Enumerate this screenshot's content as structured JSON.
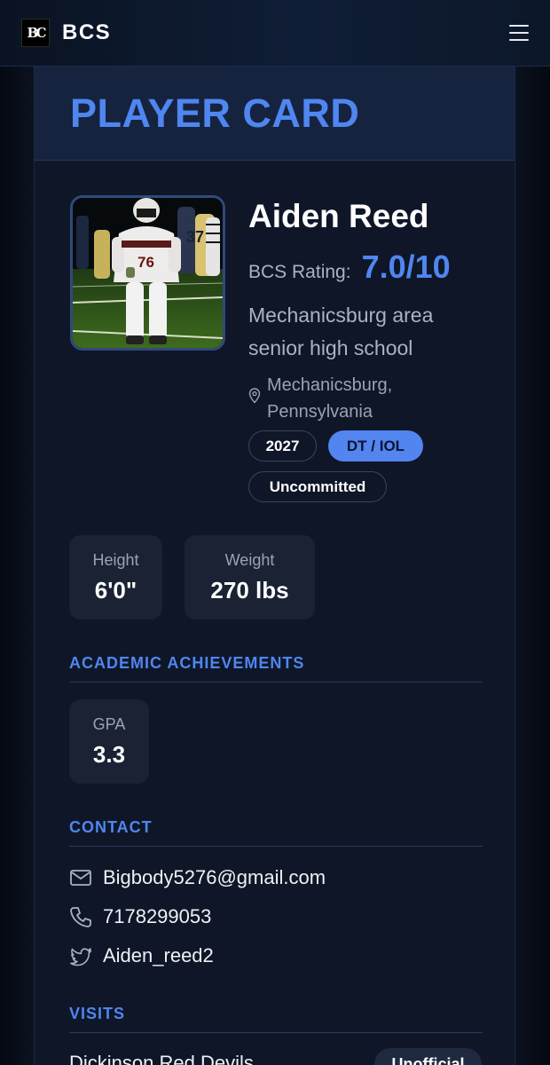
{
  "nav": {
    "logo": "BC",
    "brand": "BCS"
  },
  "card": {
    "title": "PLAYER CARD"
  },
  "player": {
    "name": "Aiden Reed",
    "rating_label": "BCS Rating:",
    "rating_value": "7.0/10",
    "school": "Mechanicsburg area senior high school",
    "location": "Mechanicsburg, Pennsylvania",
    "class_year": "2027",
    "position": "DT / IOL",
    "commit_status": "Uncommitted",
    "jersey_number": "76"
  },
  "stats": {
    "height_label": "Height",
    "height_value": "6'0\"",
    "weight_label": "Weight",
    "weight_value": "270 lbs"
  },
  "academic": {
    "title": "ACADEMIC ACHIEVEMENTS",
    "gpa_label": "GPA",
    "gpa_value": "3.3"
  },
  "contact": {
    "title": "CONTACT",
    "email": "Bigbody5276@gmail.com",
    "phone": "7178299053",
    "twitter": "Aiden_reed2"
  },
  "visits": {
    "title": "VISITS",
    "items": [
      {
        "school": "Dickinson Red Devils",
        "type": "Unofficial"
      }
    ]
  },
  "colors": {
    "accent": "#4f86f0",
    "card_bg": "#0f1627",
    "stat_bg": "#1a2234"
  },
  "icons": [
    "menu-icon",
    "location-pin-icon",
    "mail-icon",
    "phone-icon",
    "twitter-icon"
  ]
}
